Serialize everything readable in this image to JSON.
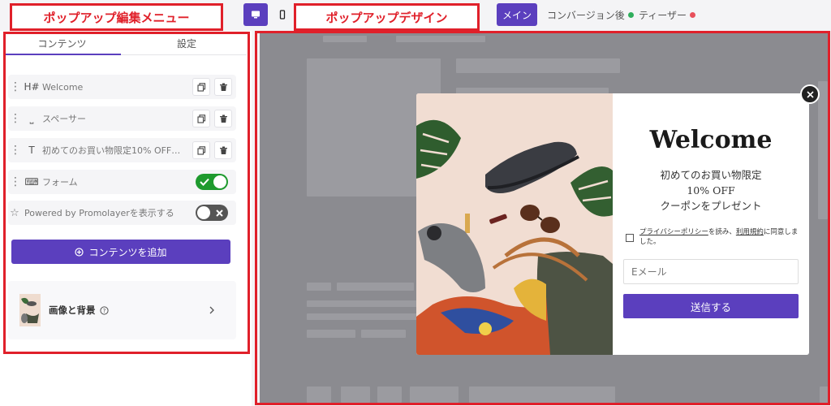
{
  "annotations": {
    "left_label": "ポップアップ編集メニュー",
    "center_label": "ポップアップデザイン"
  },
  "topbar": {
    "devices": [
      "desktop-icon",
      "mobile-icon"
    ],
    "tabs": [
      {
        "label": "メイン",
        "active": true
      },
      {
        "label": "コンバージョン後",
        "dot_color": "#2fae5c"
      },
      {
        "label": "ティーザー",
        "dot_color": "#e8505b"
      }
    ]
  },
  "panel": {
    "tabs": [
      "コンテンツ",
      "設定"
    ],
    "rows": [
      {
        "icon": "heading-icon",
        "icon_text": "H#",
        "label": "Welcome"
      },
      {
        "icon": "spacer-icon",
        "icon_text": "⎵",
        "label": "スペーサー"
      },
      {
        "icon": "text-icon",
        "icon_text": "T",
        "label": "初めてのお買い物限定10% OFF…"
      },
      {
        "icon": "form-icon",
        "icon_text": "⌨",
        "label": "フォーム",
        "toggle": "on"
      }
    ],
    "powered": {
      "label": "Powered by Promolayerを表示する",
      "toggle": "off"
    },
    "add_button": "コンテンツを追加",
    "image_bg": "画像と背景"
  },
  "popup": {
    "title": "Welcome",
    "subtitle_lines": [
      "初めてのお買い物限定",
      "10% OFF",
      "クーポンをプレゼント"
    ],
    "consent": {
      "link1": "プライバシーポリシー",
      "mid": "を読み、",
      "link2": "利用規約",
      "end": "に同意しました。"
    },
    "email_placeholder": "Eメール",
    "submit": "送信する"
  },
  "colors": {
    "accent": "#5b3fbe",
    "annotation": "#e0202a",
    "toggle_on": "#1e9a2e"
  }
}
